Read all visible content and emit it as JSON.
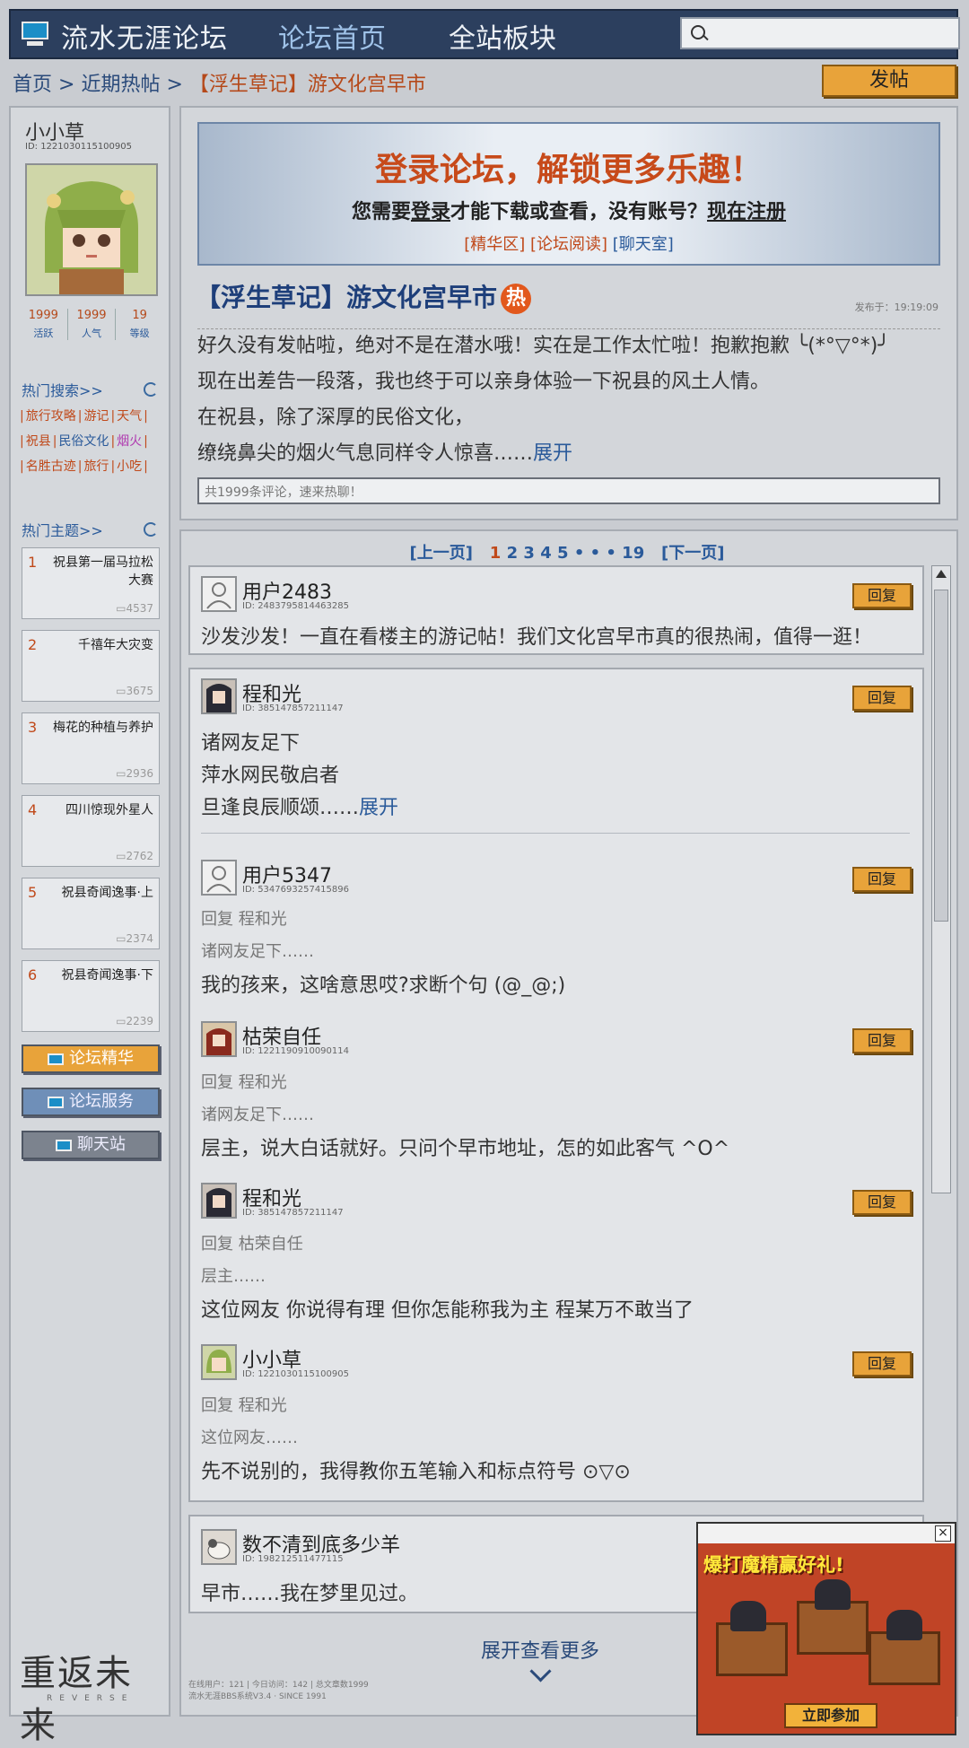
{
  "header": {
    "site_title": "流水无涯论坛",
    "nav_home": "论坛首页",
    "nav_boards": "全站板块",
    "search_placeholder": ""
  },
  "breadcrumb": {
    "home": "首页",
    "sep1": " > ",
    "section": "近期热帖",
    "sep2": " > ",
    "current": "【浮生草记】游文化宫早市"
  },
  "post_button": "发帖",
  "sidebar": {
    "username": "小小草",
    "user_id": "ID: 1221030115100905",
    "stats": [
      {
        "value": "1999",
        "label": "活跃"
      },
      {
        "value": "1999",
        "label": "人气"
      },
      {
        "value": "19",
        "label": "等级"
      }
    ],
    "hot_search_title": "热门搜索>>",
    "tags": [
      {
        "text": "旅行攻略",
        "color": "#c0491a"
      },
      {
        "text": "游记",
        "color": "#c0491a"
      },
      {
        "text": "天气",
        "color": "#c0491a"
      },
      {
        "text": "祝县",
        "color": "#c0491a"
      },
      {
        "text": "民俗文化",
        "color": "#2a5a9a"
      },
      {
        "text": "烟火",
        "color": "#b03ab0"
      },
      {
        "text": "名胜古迹",
        "color": "#c0491a"
      },
      {
        "text": "旅行",
        "color": "#c0491a"
      },
      {
        "text": "小吃",
        "color": "#c0491a"
      }
    ],
    "hot_topics_title": "热门主题>>",
    "topics": [
      {
        "num": "1",
        "title": "祝县第一届马拉松大赛",
        "count": "4537"
      },
      {
        "num": "2",
        "title": "千禧年大灾变",
        "count": "3675"
      },
      {
        "num": "3",
        "title": "梅花的种植与养护",
        "count": "2936"
      },
      {
        "num": "4",
        "title": "四川惊现外星人",
        "count": "2762"
      },
      {
        "num": "5",
        "title": "祝县奇闻逸事·上",
        "count": "2374"
      },
      {
        "num": "6",
        "title": "祝县奇闻逸事·下",
        "count": "2239"
      }
    ],
    "buttons": [
      "论坛精华",
      "论坛服务",
      "聊天站"
    ],
    "brand": "重返未来",
    "brand_sub": "REVERSE"
  },
  "banner": {
    "headline": "登录论坛，解锁更多乐趣！",
    "line_a": "您需要",
    "line_login": "登录",
    "line_b": "才能下载或查看，没有账号？",
    "line_register": "现在注册",
    "links": [
      "[精华区]",
      "[论坛阅读]",
      "[聊天室]"
    ]
  },
  "post": {
    "title": "【浮生草记】游文化宫早市",
    "hot_badge": "热",
    "time": "发布于：19:19:09",
    "lines": [
      "好久没有发帖啦，绝对不是在潜水哦！实在是工作太忙啦！抱歉抱歉 ╰(*°▽°*)╯",
      "现在出差告一段落，我也终于可以亲身体验一下祝县的风土人情。",
      "在祝县，除了深厚的民俗文化，",
      "缭绕鼻尖的烟火气息同样令人惊喜……"
    ],
    "expand": "展开",
    "comment_placeholder": "共1999条评论，速来热聊！"
  },
  "pager": {
    "prev": "[上一页]",
    "pages": [
      "1",
      "2",
      "3",
      "4",
      "5"
    ],
    "dots": "• • •",
    "last": "19",
    "next": "[下一页]"
  },
  "reply_label": "回复",
  "comments": {
    "c1": {
      "name": "用户2483",
      "id": "ID: 2483795814463285",
      "text": "沙发沙发！一直在看楼主的游记帖！我们文化宫早市真的很热闹，值得一逛！"
    },
    "c2": {
      "name": "程和光",
      "id": "ID: 385147857211147",
      "lines": [
        "诸网友足下",
        "萍水网民敬启者",
        "旦逢良辰顺颂……"
      ],
      "expand": "展开"
    },
    "r1": {
      "name": "用户5347",
      "id": "ID: 5347693257415896",
      "reply_to": "回复 程和光",
      "quote": "诸网友足下……",
      "text": "我的孩来，这啥意思哎?求断个句 (@_@;)"
    },
    "r2": {
      "name": "枯荣自任",
      "id": "ID: 1221190910090114",
      "reply_to": "回复 程和光",
      "quote": "诸网友足下……",
      "text": "层主，说大白话就好。只问个早市地址，怎的如此客气 ^O^"
    },
    "r3": {
      "name": "程和光",
      "id": "ID: 385147857211147",
      "reply_to": "回复 枯荣自任",
      "quote": "层主……",
      "text": "这位网友  你说得有理  但你怎能称我为主  程某万不敢当了"
    },
    "r4": {
      "name": "小小草",
      "id": "ID: 1221030115100905",
      "reply_to": "回复 程和光",
      "quote": "这位网友……",
      "text": "先不说别的，我得教你五笔输入和标点符号 ⊙▽⊙"
    },
    "c3": {
      "name": "数不清到底多少羊",
      "id": "ID: 198212511477115",
      "text": "早市……我在梦里见过。"
    }
  },
  "more": "展开查看更多",
  "footer": [
    "在线用户：121 | 今日访问：142 | 总文章数1999",
    "流水无涯BBS系统V3.4 · SINCE 1991"
  ],
  "ad": {
    "headline": "爆打魔精赢好礼!",
    "cta": "立即参加",
    "close": "×"
  }
}
